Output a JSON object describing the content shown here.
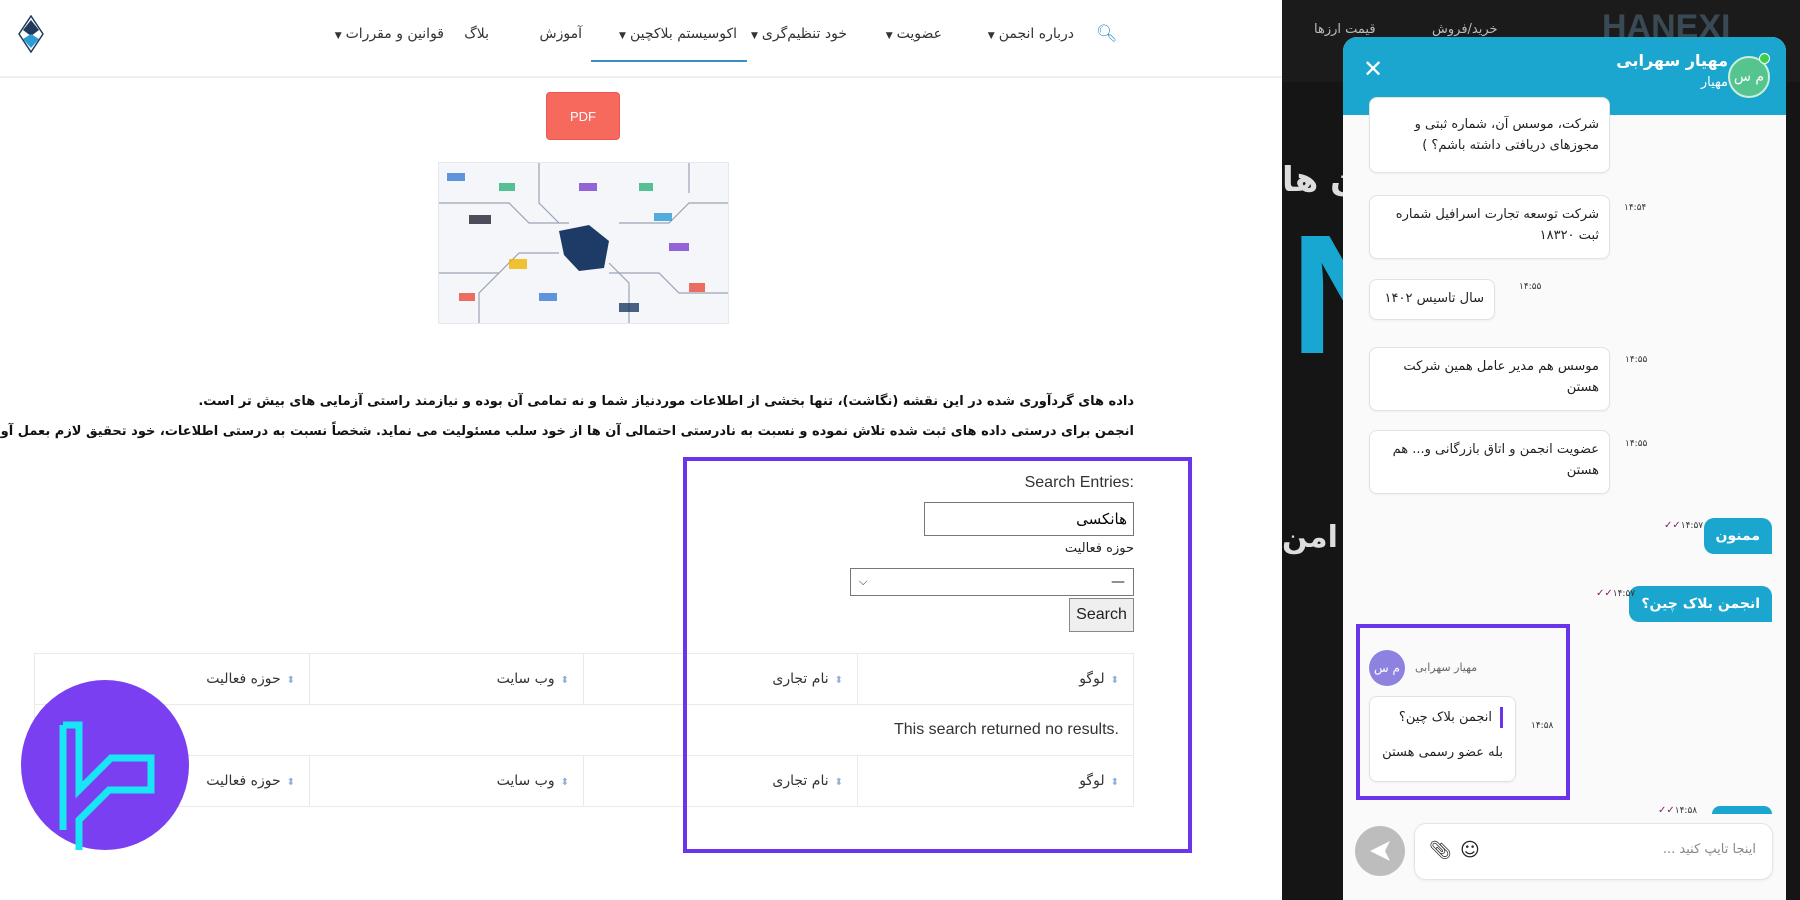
{
  "nav": {
    "items": [
      {
        "label": "درباره انجمن",
        "dropdown": true
      },
      {
        "label": "عضویت",
        "dropdown": true
      },
      {
        "label": "خود تنظیم‌گری",
        "dropdown": true
      },
      {
        "label": "اکوسیستم بلاکچین",
        "dropdown": true,
        "active": true
      },
      {
        "label": "آموزش",
        "dropdown": false
      },
      {
        "label": "بلاگ",
        "dropdown": false
      },
      {
        "label": "قوانین و مقررات",
        "dropdown": true
      }
    ],
    "search_icon": "search-icon",
    "accent": "#3a8fc4"
  },
  "main": {
    "pdf_label": "PDF",
    "disclaimer": [
      "داده های گردآوری شده در این نقشه (نگاشت)، تنها بخشی از اطلاعات موردنیاز شما و نه تمامی آن بوده و نیازمند راستی آزمایی های بیش تر است.",
      "انجمن برای درستی داده های ثبت شده تلاش نموده و نسبت به نادرستی احتمالی آن ها از خود سلب مسئولیت می نماید. شخصاً نسبت به درستی اطلاعات، خود تحقیق لازم بعمل آورید."
    ],
    "search": {
      "label": ":Search Entries",
      "value": "هانکسی",
      "field_label": "حوزه فعالیت",
      "select_value": "—",
      "button": "Search"
    },
    "table": {
      "columns": [
        "لوگو",
        "نام تجاری",
        "وب سایت",
        "حوزه فعالیت"
      ],
      "empty": ".This search returned no results"
    }
  },
  "background_site": {
    "nav": [
      "قیمت ارزها",
      "خرید/فروش"
    ],
    "logo": "HANEXI",
    "hero_fragments": [
      "ن ها",
      "N",
      "امن"
    ]
  },
  "chat": {
    "header": {
      "name": "مهیار سهرابی",
      "subtitle": "مهیار",
      "avatar": "م س",
      "status": "online"
    },
    "messages": [
      {
        "type": "received",
        "text": "شرکت، موسس آن، شماره ثبتی و مجوزهای دریافتی داشته باشم؟ )",
        "time": ""
      },
      {
        "type": "received",
        "text": "شرکت توسعه تجارت اسرافیل شماره ثبت ۱۸۳۲۰",
        "time": "۱۴:۵۴"
      },
      {
        "type": "received",
        "text": "سال تاسیس ۱۴۰۲",
        "time": "۱۴:۵۵"
      },
      {
        "type": "received",
        "text": "موسس هم مدیر عامل همین شرکت هستن",
        "time": "۱۴:۵۵"
      },
      {
        "type": "received",
        "text": "عضویت انجمن و اتاق بازرگانی و... هم هستن",
        "time": "۱۴:۵۵"
      },
      {
        "type": "sent",
        "text": "ممنون",
        "time": "۱۴:۵۷"
      },
      {
        "type": "sent",
        "text": "انجمن بلاک چین؟",
        "time": "۱۴:۵۷"
      },
      {
        "type": "received",
        "sender": "مهیار سهرابی",
        "avatar": "م س",
        "quote": "انجمن بلاک چین؟",
        "text": "بله عضو رسمی هستن",
        "time": "۱۴:۵۸"
      },
      {
        "type": "sent",
        "text": "",
        "time": "۱۴:۵۸"
      }
    ],
    "input_placeholder": "اینجا تایپ کنید ...",
    "colors": {
      "header": "#1ba6cf",
      "highlight": "#6a35ea"
    }
  }
}
